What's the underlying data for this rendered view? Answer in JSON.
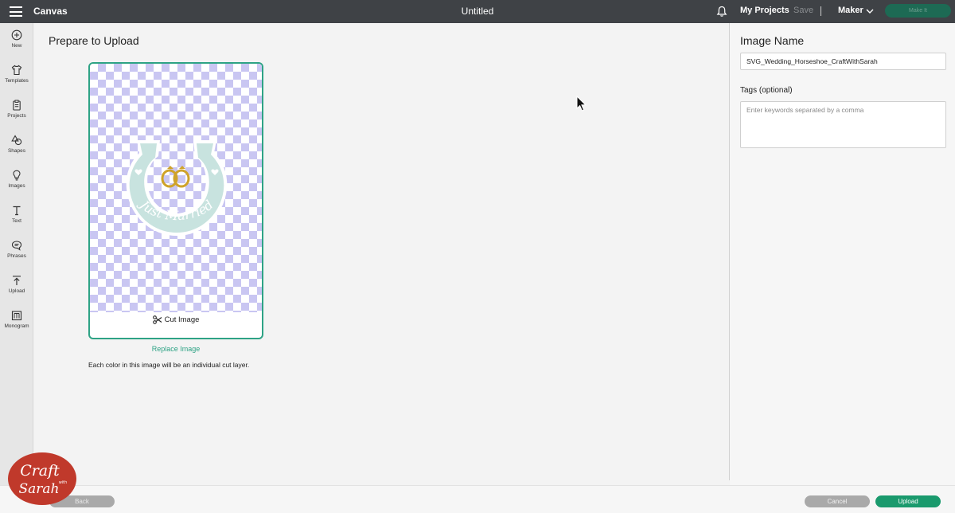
{
  "header": {
    "menu_icon": "hamburger-menu-icon",
    "app_name": "Canvas",
    "document_title": "Untitled",
    "notifications_icon": "bell-icon",
    "my_projects": "My Projects",
    "save": "Save",
    "machine": "Maker",
    "machine_dropdown_icon": "chevron-down-icon",
    "make_it": "Make It"
  },
  "sidebar": {
    "items": [
      {
        "label": "New",
        "icon": "plus-circle-icon"
      },
      {
        "label": "Templates",
        "icon": "shirt-icon"
      },
      {
        "label": "Projects",
        "icon": "clipboard-icon"
      },
      {
        "label": "Shapes",
        "icon": "shapes-icon"
      },
      {
        "label": "Images",
        "icon": "lightbulb-icon"
      },
      {
        "label": "Text",
        "icon": "text-icon"
      },
      {
        "label": "Phrases",
        "icon": "speech-bubble-icon"
      },
      {
        "label": "Upload",
        "icon": "upload-icon"
      },
      {
        "label": "Monogram",
        "icon": "monogram-icon"
      }
    ]
  },
  "main": {
    "title": "Prepare to Upload",
    "preview": {
      "cut_type_label": "Cut Image",
      "cut_type_icon": "scissors-icon",
      "image_text": "Just Married"
    },
    "replace_link": "Replace Image",
    "note": "Each color in this image will be an individual cut layer."
  },
  "right_panel": {
    "image_name_heading": "Image Name",
    "image_name_value": "SVG_Wedding_Horseshoe_CraftWithSarah",
    "tags_label": "Tags (optional)",
    "tags_placeholder": "Enter keywords separated by a comma"
  },
  "footer": {
    "back": "Back",
    "cancel": "Cancel",
    "upload": "Upload"
  },
  "watermark": {
    "line1": "Craft",
    "line2": "with",
    "line3": "Sarah"
  },
  "colors": {
    "accent": "#2ea385",
    "topbar": "#3f4246",
    "upload_button": "#1a9a6d",
    "logo_red": "#c0392b"
  }
}
